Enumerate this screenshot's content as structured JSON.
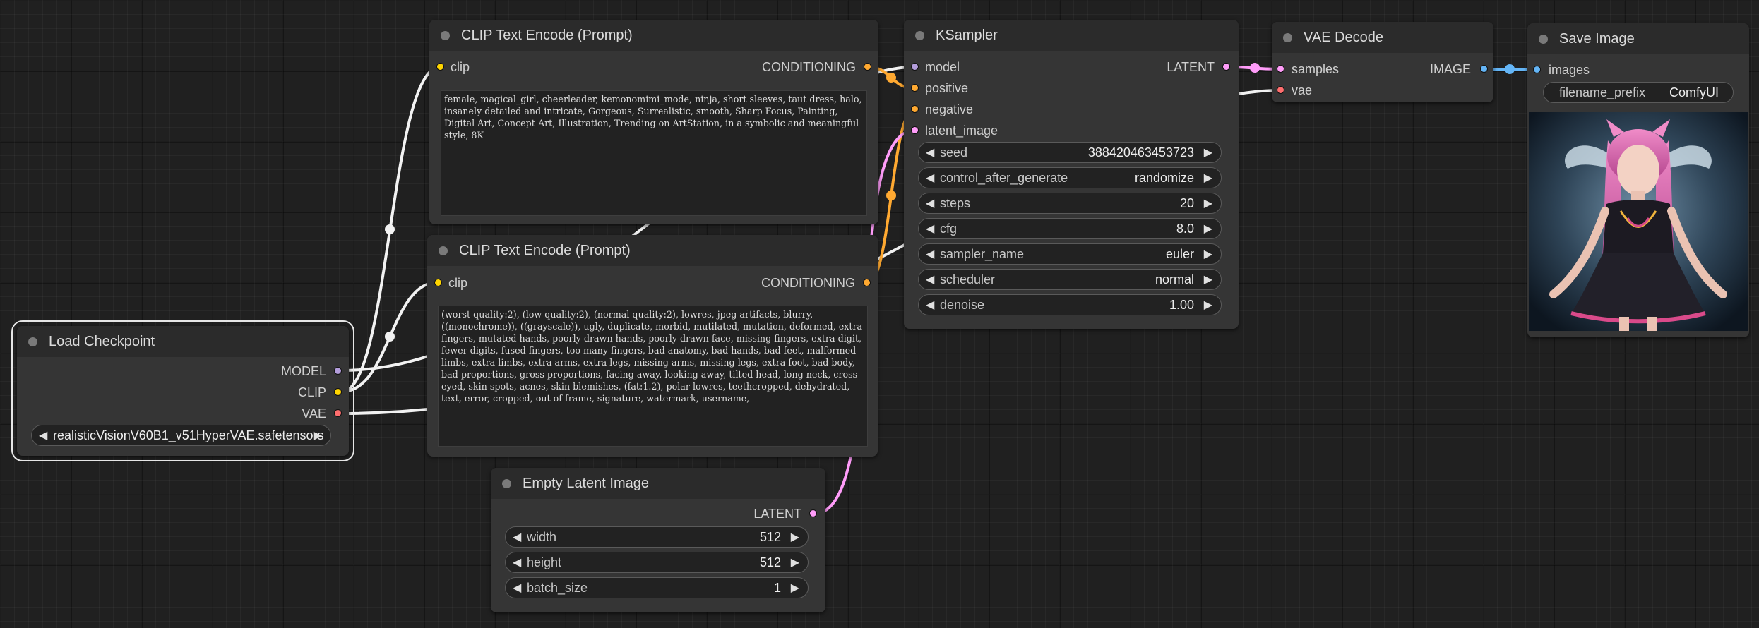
{
  "colors": {
    "model": "#b39ddb",
    "clip": "#ffd500",
    "vae": "#ff6e6e",
    "conditioning": "#ffa931",
    "latent": "#ff9cf9",
    "image": "#64b5f6",
    "node_bg": "#353535",
    "title_bg": "#2b2b2b",
    "canvas_bg": "#202020"
  },
  "nodes": {
    "clip_positive": {
      "title": "CLIP Text Encode (Prompt)",
      "input_clip": "clip",
      "output_conditioning": "CONDITIONING",
      "text": "female, magical_girl, cheerleader, kemonomimi_mode, ninja, short sleeves, taut dress, halo, insanely detailed and intricate, Gorgeous, Surrealistic, smooth, Sharp Focus, Painting, Digital Art, Concept Art, Illustration, Trending on ArtStation, in a symbolic and meaningful style, 8K"
    },
    "clip_negative": {
      "title": "CLIP Text Encode (Prompt)",
      "input_clip": "clip",
      "output_conditioning": "CONDITIONING",
      "text": "(worst quality:2), (low quality:2), (normal quality:2), lowres, jpeg artifacts, blurry, ((monochrome)), ((grayscale)), ugly, duplicate, morbid, mutilated, mutation, deformed, extra fingers, mutated hands, poorly drawn hands, poorly drawn face, missing fingers, extra digit, fewer digits, fused fingers, too many fingers, bad anatomy, bad hands, bad feet, malformed limbs, extra limbs, extra arms, extra legs, missing arms, missing legs, extra foot, bad body, bad proportions, gross proportions, facing away, looking away, tilted head, long neck, cross-eyed, skin spots, acnes, skin blemishes, (fat:1.2), polar lowres, teethcropped, dehydrated, text, error, cropped, out of frame, signature, watermark, username,"
    },
    "load_checkpoint": {
      "title": "Load Checkpoint",
      "output_model": "MODEL",
      "output_clip": "CLIP",
      "output_vae": "VAE",
      "ckpt_name": "realisticVisionV60B1_v51HyperVAE.safetensors"
    },
    "ksampler": {
      "title": "KSampler",
      "input_model": "model",
      "input_positive": "positive",
      "input_negative": "negative",
      "input_latent": "latent_image",
      "output_latent": "LATENT",
      "widgets": [
        {
          "label": "seed",
          "value": "388420463453723"
        },
        {
          "label": "control_after_generate",
          "value": "randomize"
        },
        {
          "label": "steps",
          "value": "20"
        },
        {
          "label": "cfg",
          "value": "8.0"
        },
        {
          "label": "sampler_name",
          "value": "euler"
        },
        {
          "label": "scheduler",
          "value": "normal"
        },
        {
          "label": "denoise",
          "value": "1.00"
        }
      ]
    },
    "vae_decode": {
      "title": "VAE Decode",
      "input_samples": "samples",
      "input_vae": "vae",
      "output_image": "IMAGE"
    },
    "save_image": {
      "title": "Save Image",
      "input_images": "images",
      "filename_prefix_label": "filename_prefix",
      "filename_prefix_value": "ComfyUI"
    },
    "empty_latent": {
      "title": "Empty Latent Image",
      "output_latent": "LATENT",
      "widgets": [
        {
          "label": "width",
          "value": "512"
        },
        {
          "label": "height",
          "value": "512"
        },
        {
          "label": "batch_size",
          "value": "1"
        }
      ]
    }
  }
}
